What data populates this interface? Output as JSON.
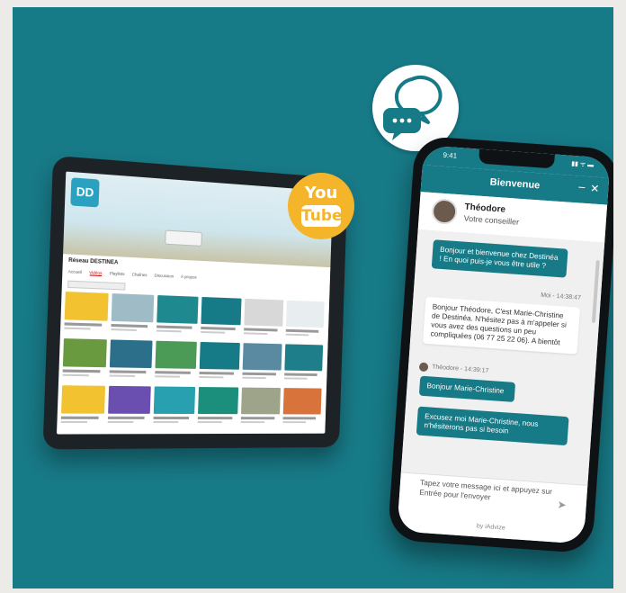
{
  "tablet": {
    "channel_name": "Réseau DESTINEA",
    "logo_text": "DD",
    "tabs": [
      {
        "label": "Accueil",
        "active": false
      },
      {
        "label": "Vidéos",
        "active": true
      },
      {
        "label": "Playlists",
        "active": false
      },
      {
        "label": "Chaînes",
        "active": false
      },
      {
        "label": "Discussion",
        "active": false
      },
      {
        "label": "À propos",
        "active": false
      }
    ],
    "thumb_colors": [
      "#f2c230",
      "#9fbcc6",
      "#1e8a8f",
      "#177a87",
      "#d8d8d8",
      "#e8eef0",
      "#6a9a40",
      "#2c6f8a",
      "#4b9a55",
      "#177a87",
      "#5a8aa2",
      "#1e7f8a",
      "#f2c230",
      "#6a4fb0",
      "#28a0b0",
      "#1c8f7c",
      "#9ea48a",
      "#d9733c"
    ]
  },
  "youtube": {
    "you": "You",
    "tube": "Tube"
  },
  "phone": {
    "status_time": "9:41",
    "status_icons": "▮▮ ᯤ ▬",
    "header_title": "Bienvenue",
    "minimize_glyph": "–",
    "close_glyph": "✕",
    "agent_name": "Théodore",
    "agent_role": "Votre conseiller",
    "messages": [
      {
        "kind": "in",
        "text": "Bonjour et bienvenue chez Destinéa ! En quoi puis-je vous être utile ?"
      },
      {
        "kind": "meta",
        "text": "Moi - 14:38:47"
      },
      {
        "kind": "out",
        "text": "Bonjour Théodore, C'est Marie-Christine de Destinéa. N'hésitez pas à m'appeler si vous avez des questions un peu compliquées (06 77 25 22 06). A bientôt"
      },
      {
        "kind": "meta",
        "text": "Théodore - 14:39:17"
      },
      {
        "kind": "in",
        "text": "Bonjour Marie-Christine"
      },
      {
        "kind": "in",
        "text": "Excusez moi Marie-Christine, nous n'hésiterons pas si besoin"
      }
    ],
    "input_text": "Tapez votre message ici et appuyez sur Entrée pour l'envoyer",
    "send_glyph": "➤",
    "footer": "by iAdvize"
  }
}
